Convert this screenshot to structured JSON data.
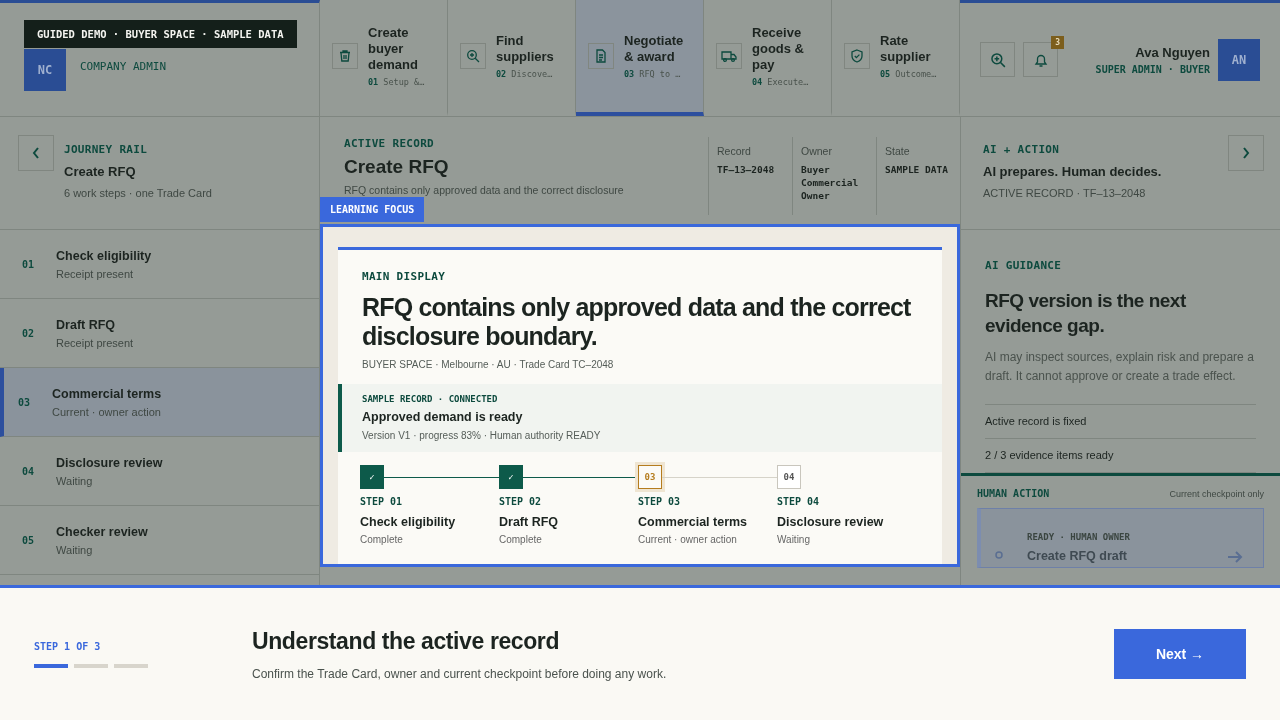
{
  "demo_tag": "GUIDED DEMO · BUYER SPACE · SAMPLE DATA",
  "company": {
    "initials": "NC",
    "role": "COMPANY ADMIN"
  },
  "stages": [
    {
      "title": "Create buyer demand",
      "num": "01",
      "sub": "Setup &…",
      "selected": false
    },
    {
      "title": "Find suppliers",
      "num": "02",
      "sub": "Discove…",
      "selected": false
    },
    {
      "title": "Negotiate & award",
      "num": "03",
      "sub": "RFQ to …",
      "selected": true
    },
    {
      "title": "Receive goods & pay",
      "num": "04",
      "sub": "Execute…",
      "selected": false
    },
    {
      "title": "Rate supplier",
      "num": "05",
      "sub": "Outcome…",
      "selected": false
    }
  ],
  "user": {
    "name": "Ava Nguyen",
    "role": "SUPER ADMIN · BUYER",
    "initials": "AN",
    "notifications": "3"
  },
  "journey": {
    "label": "JOURNEY RAIL",
    "title": "Create RFQ",
    "sub": "6 work steps · one Trade Card"
  },
  "active_record": {
    "label": "ACTIVE RECORD",
    "title": "Create RFQ",
    "sub": "RFQ contains only approved data and the correct disclosure",
    "fields": [
      {
        "label": "Record",
        "value": "TF–13–2048"
      },
      {
        "label": "Owner",
        "value": "Buyer Commercial Owner"
      },
      {
        "label": "State",
        "value": "SAMPLE DATA"
      }
    ]
  },
  "ai_action": {
    "label": "AI + ACTION",
    "title": "AI prepares. Human decides.",
    "sub": "ACTIVE RECORD · TF–13–2048"
  },
  "work_steps": [
    {
      "num": "01",
      "title": "Check eligibility",
      "sub": "Receipt present",
      "selected": false
    },
    {
      "num": "02",
      "title": "Draft RFQ",
      "sub": "Receipt present",
      "selected": false
    },
    {
      "num": "03",
      "title": "Commercial terms",
      "sub": "Current · owner action",
      "selected": true
    },
    {
      "num": "04",
      "title": "Disclosure review",
      "sub": "Waiting",
      "selected": false
    },
    {
      "num": "05",
      "title": "Checker review",
      "sub": "Waiting",
      "selected": false
    }
  ],
  "focus_label": "LEARNING FOCUS",
  "main_display": {
    "label": "MAIN DISPLAY",
    "title": "RFQ contains only approved data and the correct disclosure boundary.",
    "meta": "BUYER SPACE · Melbourne · AU · Trade Card TC–2048",
    "record": {
      "label": "SAMPLE RECORD · CONNECTED",
      "title": "Approved demand is ready",
      "sub": "Version V1 · progress 83% · Human authority READY"
    },
    "steps": [
      {
        "kind": "complete",
        "marker": "✓",
        "label": "STEP 01",
        "title": "Check eligibility",
        "sub": "Complete"
      },
      {
        "kind": "complete",
        "marker": "✓",
        "label": "STEP 02",
        "title": "Draft RFQ",
        "sub": "Complete"
      },
      {
        "kind": "current",
        "marker": "03",
        "label": "STEP 03",
        "title": "Commercial terms",
        "sub": "Current · owner action"
      },
      {
        "kind": "waiting",
        "marker": "04",
        "label": "STEP 04",
        "title": "Disclosure review",
        "sub": "Waiting"
      }
    ]
  },
  "guidance": {
    "label": "AI GUIDANCE",
    "title": "RFQ version is the next evidence gap.",
    "text": "AI may inspect sources, explain risk and prepare a draft. It cannot approve or create a trade effect.",
    "checks": [
      "Active record is fixed",
      "2 / 3 evidence items ready"
    ]
  },
  "human_action": {
    "label": "HUMAN ACTION",
    "note": "Current checkpoint only",
    "card_label": "READY · HUMAN OWNER",
    "card_title": "Create RFQ draft"
  },
  "tour": {
    "step": "STEP 1 OF 3",
    "progress": [
      true,
      false,
      false
    ],
    "title": "Understand the active record",
    "text": "Confirm the Trade Card, owner and current checkpoint before doing any work.",
    "next": "Next →"
  }
}
